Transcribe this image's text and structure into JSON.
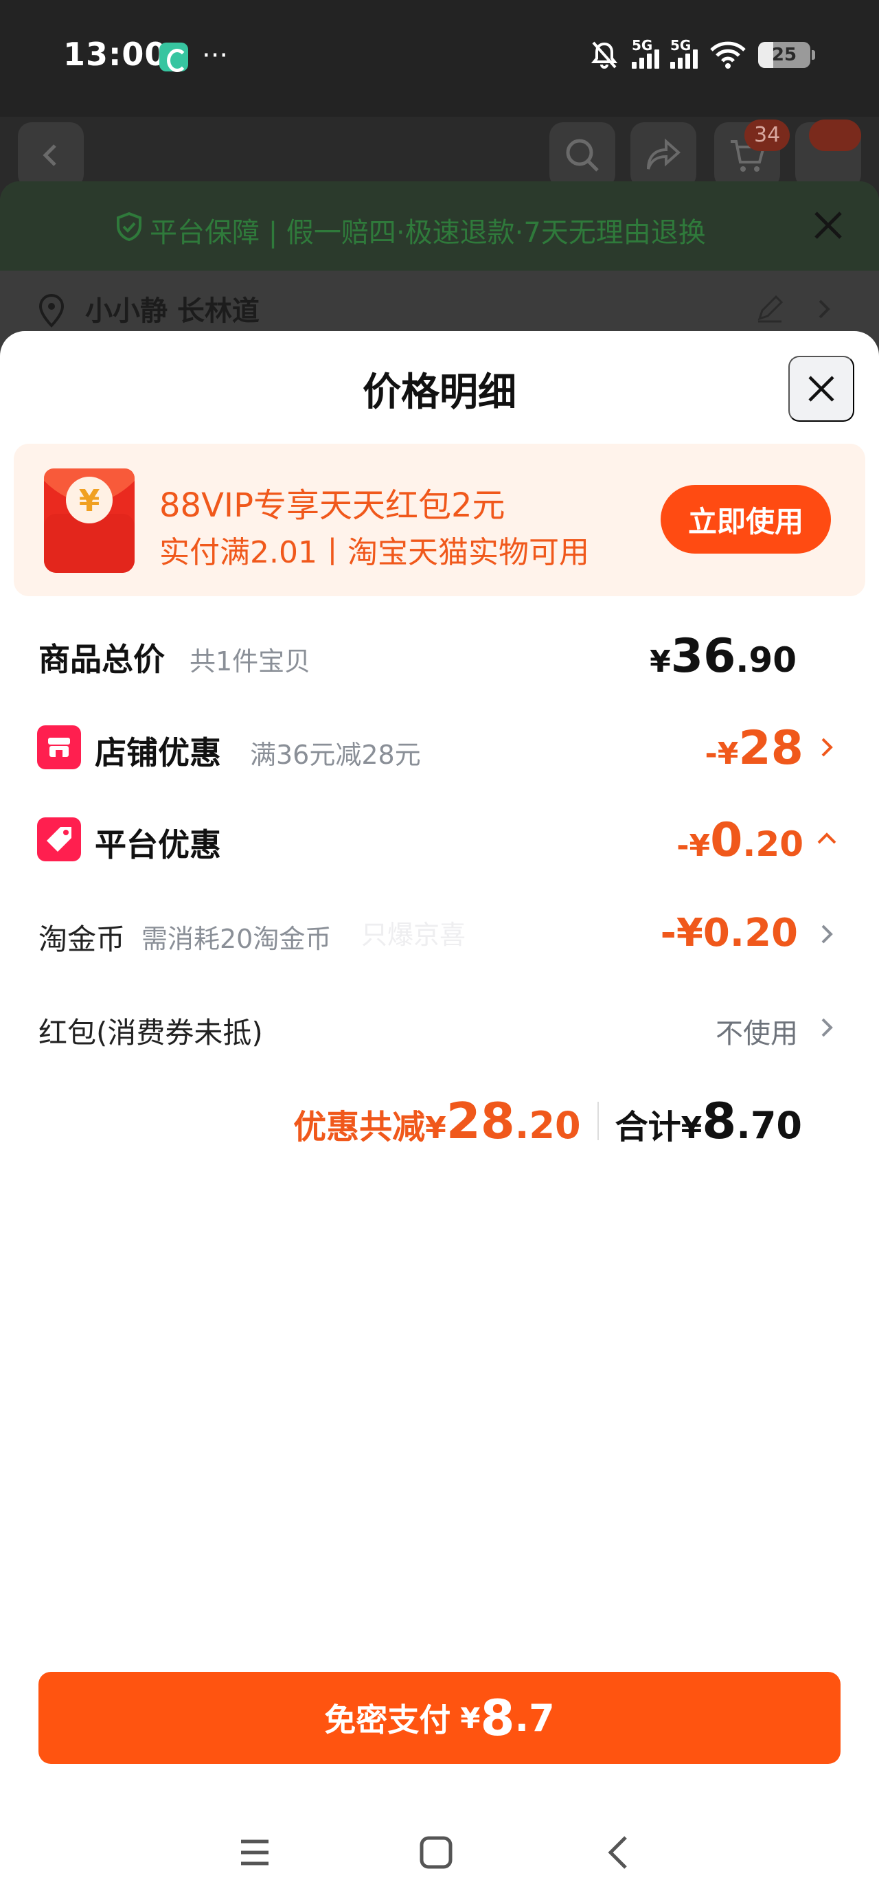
{
  "status_bar": {
    "time": "13:00",
    "more": "···",
    "signal1_label": "5G",
    "signal2_label": "5G",
    "battery": "25",
    "icons": [
      "app-icon",
      "mute-bell-icon",
      "signal-icon",
      "wifi-icon",
      "battery-icon"
    ]
  },
  "background_page": {
    "cart_badge": "34",
    "guarantee_text": "平台保障 | 假一赔四·极速退款·7天无理由退换",
    "address": "小小静 长林道",
    "icons": [
      "back-icon",
      "search-icon",
      "share-icon",
      "cart-icon",
      "close-icon",
      "location-icon",
      "edit-icon",
      "chevron-right-icon"
    ]
  },
  "sheet": {
    "title": "价格明细",
    "promo": {
      "line1": "88VIP专享天天红包2元",
      "line2": "实付满2.01丨淘宝天猫实物可用",
      "button": "立即使用"
    },
    "goods_total": {
      "label": "商品总价",
      "sub": "共1件宝贝",
      "currency": "¥",
      "int": "36",
      "dec": ".90"
    },
    "store_discount": {
      "label": "店铺优惠",
      "sub": "满36元减28元",
      "prefix": "-¥",
      "int": "28"
    },
    "platform_discount": {
      "label": "平台优惠",
      "prefix": "-¥",
      "int": "0",
      "dec": ".20"
    },
    "coins": {
      "label": "淘金币",
      "sub": "需消耗20淘金币",
      "ghost": "只爆京喜",
      "amount": "-¥0.20"
    },
    "red_packet": {
      "label": "红包(消费券未抵)",
      "value": "不使用"
    },
    "summary": {
      "discount_label": "优惠共减",
      "discount_currency": "¥",
      "discount_int": "28",
      "discount_dec": ".20",
      "total_label": "合计",
      "total_currency": "¥",
      "total_int": "8",
      "total_dec": ".70"
    },
    "pay_button": {
      "label": "免密支付",
      "currency": "¥",
      "int": "8",
      "dec": ".7"
    }
  },
  "nav": {
    "icons": [
      "menu-icon",
      "home-icon",
      "back-icon"
    ]
  },
  "colors": {
    "accent_orange": "#f0581b",
    "pay_button": "#ff5410",
    "promo_button": "#ff4b12",
    "tag_red": "#ff1f4f",
    "guarantee_green": "#2f7a3b"
  }
}
